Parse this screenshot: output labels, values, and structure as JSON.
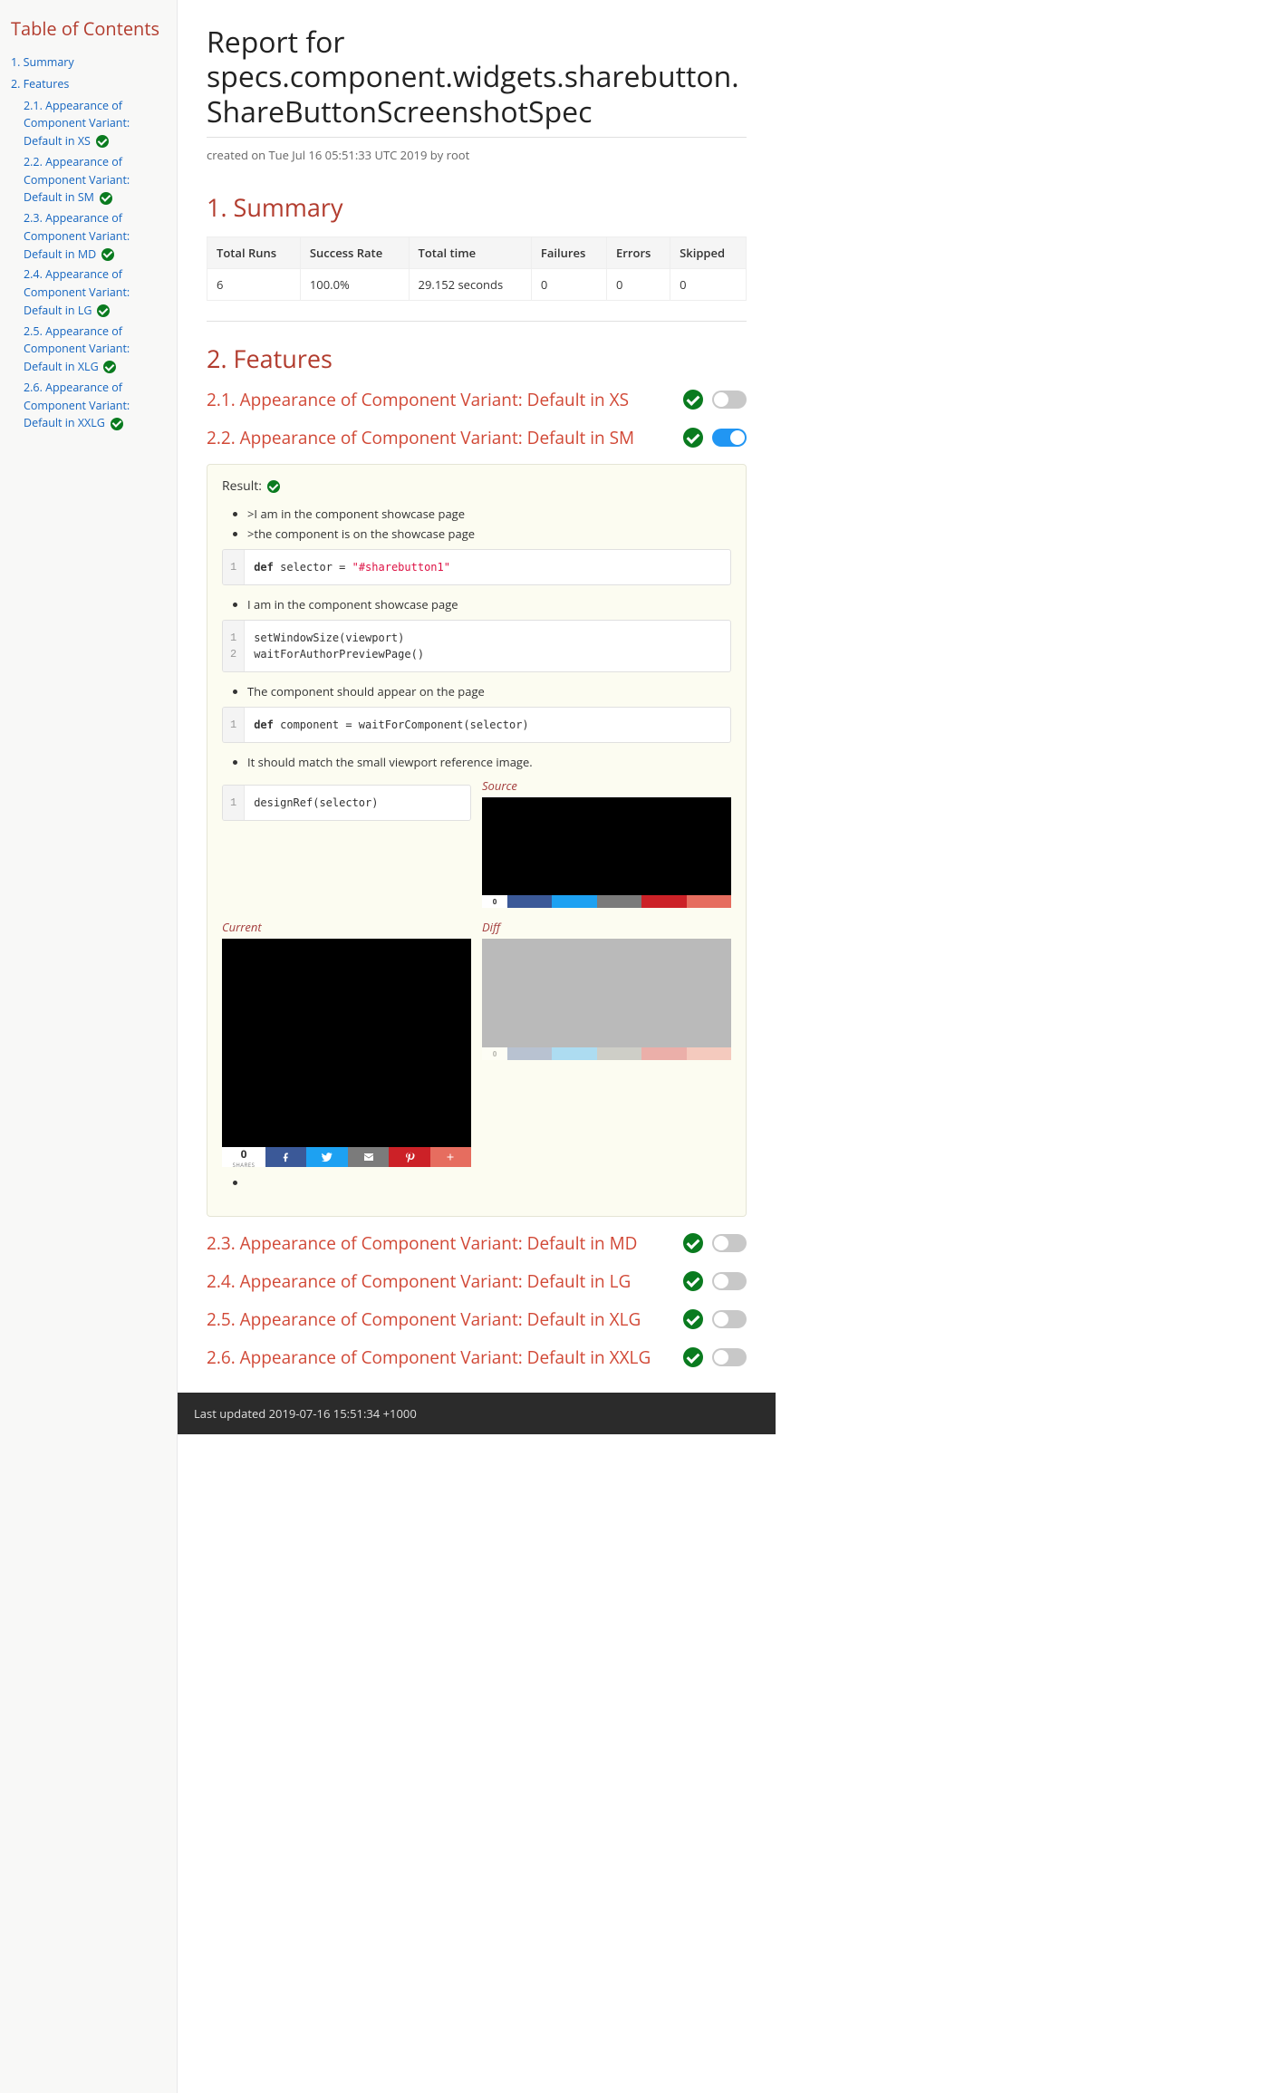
{
  "toc": {
    "title": "Table of Contents",
    "items": [
      {
        "label": "1. Summary"
      },
      {
        "label": "2. Features",
        "children": [
          {
            "label": "2.1. Appearance of Component Variant: Default in XS"
          },
          {
            "label": "2.2. Appearance of Component Variant: Default in SM"
          },
          {
            "label": "2.3. Appearance of Component Variant: Default in MD"
          },
          {
            "label": "2.4. Appearance of Component Variant: Default in LG"
          },
          {
            "label": "2.5. Appearance of Component Variant: Default in XLG"
          },
          {
            "label": "2.6. Appearance of Component Variant: Default in XXLG"
          }
        ]
      }
    ]
  },
  "title": "Report for specs.component.widgets.sharebutton. ShareButtonScreenshotSpec",
  "created": "created on Tue Jul 16 05:51:33 UTC 2019 by root",
  "summary": {
    "heading": "1. Summary",
    "headers": [
      "Total Runs",
      "Success Rate",
      "Total time",
      "Failures",
      "Errors",
      "Skipped"
    ],
    "row": [
      "6",
      "100.0%",
      "29.152 seconds",
      "0",
      "0",
      "0"
    ]
  },
  "features": {
    "heading": "2. Features",
    "list": [
      {
        "title": "2.1. Appearance of Component Variant: Default in XS",
        "expanded": false
      },
      {
        "title": "2.2. Appearance of Component Variant: Default in SM",
        "expanded": true
      },
      {
        "title": "2.3. Appearance of Component Variant: Default in MD",
        "expanded": false
      },
      {
        "title": "2.4. Appearance of Component Variant: Default in LG",
        "expanded": false
      },
      {
        "title": "2.5. Appearance of Component Variant: Default in XLG",
        "expanded": false
      },
      {
        "title": "2.6. Appearance of Component Variant: Default in XXLG",
        "expanded": false
      }
    ]
  },
  "detail": {
    "result_label": "Result:",
    "steps": [
      ">I am in the component showcase page",
      ">the component is on the showcase page"
    ],
    "code1": {
      "kw": "def",
      "rest": " selector = ",
      "str": "\"#sharebutton1\""
    },
    "step2": "I am in the component showcase page",
    "code2_lines": [
      "setWindowSize(viewport)",
      "waitForAuthorPreviewPage()"
    ],
    "step3": "The component should appear on the page",
    "code3": {
      "kw": "def",
      "rest": " component = waitForComponent(selector)"
    },
    "step4": "It should match the small viewport reference image.",
    "code4": "designRef(selector)",
    "screenshots": {
      "source": "Source",
      "current": "Current",
      "diff": "Diff"
    },
    "share": {
      "count": "0",
      "label": "SHARES",
      "colors": {
        "fb": "#3b5998",
        "tw": "#1da1f2",
        "mail": "#7b7b7b",
        "pin": "#cc2127",
        "plus": "#e66d5f"
      }
    }
  },
  "footer": "Last updated 2019-07-16 15:51:34 +1000"
}
